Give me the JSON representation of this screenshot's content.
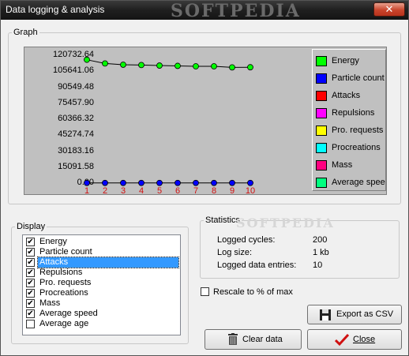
{
  "window": {
    "title": "Data logging & analysis",
    "watermark": "SOFTPEDIA",
    "close_glyph": "✕"
  },
  "graph": {
    "group_label": "Graph"
  },
  "chart_data": {
    "type": "line",
    "x": [
      1,
      2,
      3,
      4,
      5,
      6,
      7,
      8,
      9,
      10
    ],
    "y_ticks": [
      "120732.64",
      "105641.06",
      "90549.48",
      "75457.90",
      "60366.32",
      "45274.74",
      "30183.16",
      "15091.58",
      "0.00"
    ],
    "ylim": [
      0,
      120732.64
    ],
    "grid": false,
    "legend_position": "right",
    "series": [
      {
        "name": "Energy",
        "color": "#00ff00",
        "values": [
          116500,
          113000,
          111800,
          111500,
          111000,
          110700,
          110300,
          110300,
          109300,
          109400
        ]
      },
      {
        "name": "Particle count",
        "color": "#0000ff",
        "values": [
          200,
          200,
          200,
          200,
          200,
          200,
          200,
          200,
          200,
          200
        ]
      }
    ],
    "legend": [
      {
        "name": "Energy",
        "color": "#00ff00"
      },
      {
        "name": "Particle count",
        "color": "#0000ff"
      },
      {
        "name": "Attacks",
        "color": "#ff0000"
      },
      {
        "name": "Repulsions",
        "color": "#ff00ff"
      },
      {
        "name": "Pro. requests",
        "color": "#ffff00"
      },
      {
        "name": "Procreations",
        "color": "#00ffff"
      },
      {
        "name": "Mass",
        "color": "#ff0080"
      },
      {
        "name": "Average speed",
        "color": "#00ff80"
      }
    ]
  },
  "display": {
    "group_label": "Display",
    "items": [
      {
        "label": "Energy",
        "checked": true
      },
      {
        "label": "Particle count",
        "checked": true
      },
      {
        "label": "Attacks",
        "checked": true,
        "selected": true
      },
      {
        "label": "Repulsions",
        "checked": true
      },
      {
        "label": "Pro. requests",
        "checked": true
      },
      {
        "label": "Procreations",
        "checked": true
      },
      {
        "label": "Mass",
        "checked": true
      },
      {
        "label": "Average speed",
        "checked": true
      },
      {
        "label": "Average age",
        "checked": false
      }
    ]
  },
  "statistics": {
    "group_label": "Statistics",
    "watermark": "SOFTPEDIA",
    "rows": [
      {
        "label": "Logged cycles:",
        "value": "200"
      },
      {
        "label": "Log size:",
        "value": "1 kb"
      },
      {
        "label": "Logged data entries:",
        "value": "10"
      }
    ]
  },
  "rescale": {
    "label": "Rescale to % of max",
    "checked": false
  },
  "buttons": {
    "export_csv": "Export as CSV",
    "clear_data": "Clear data",
    "close": "Close"
  }
}
